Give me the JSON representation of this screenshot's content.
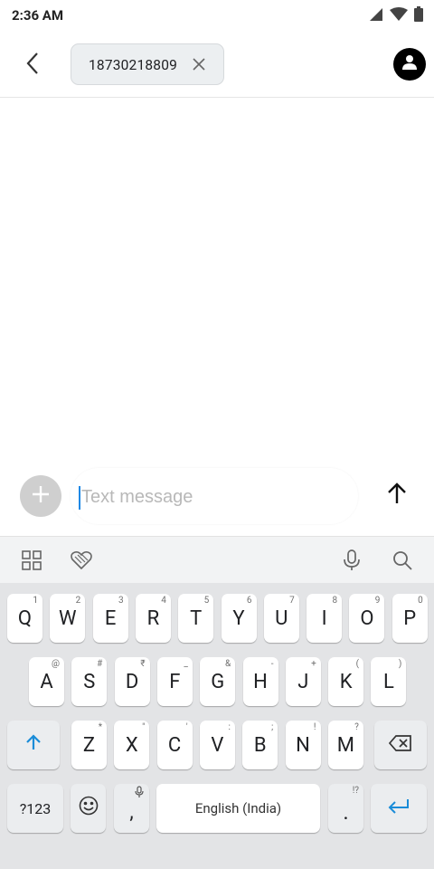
{
  "status_bar": {
    "time": "2:36 AM",
    "icons": [
      "signal-icon",
      "wifi-icon",
      "battery-icon"
    ]
  },
  "app_bar": {
    "recipient": "18730218809"
  },
  "compose": {
    "placeholder": "Text message"
  },
  "keyboard_toolbar": {
    "icons": [
      "apps-grid-icon",
      "sticker-heart-icon",
      "microphone-icon",
      "search-icon"
    ]
  },
  "keyboard": {
    "row1": [
      {
        "k": "Q",
        "h": "1"
      },
      {
        "k": "W",
        "h": "2"
      },
      {
        "k": "E",
        "h": "3"
      },
      {
        "k": "R",
        "h": "4"
      },
      {
        "k": "T",
        "h": "5"
      },
      {
        "k": "Y",
        "h": "6"
      },
      {
        "k": "U",
        "h": "7"
      },
      {
        "k": "I",
        "h": "8"
      },
      {
        "k": "O",
        "h": "9"
      },
      {
        "k": "P",
        "h": "0"
      }
    ],
    "row2": [
      {
        "k": "A",
        "h": "@"
      },
      {
        "k": "S",
        "h": "#"
      },
      {
        "k": "D",
        "h": "₹"
      },
      {
        "k": "F",
        "h": "_"
      },
      {
        "k": "G",
        "h": "&"
      },
      {
        "k": "H",
        "h": "-"
      },
      {
        "k": "J",
        "h": "+"
      },
      {
        "k": "K",
        "h": "("
      },
      {
        "k": "L",
        "h": ")"
      }
    ],
    "row3": [
      {
        "k": "Z",
        "h": "*"
      },
      {
        "k": "X",
        "h": "\""
      },
      {
        "k": "C",
        "h": "'"
      },
      {
        "k": "V",
        "h": ":"
      },
      {
        "k": "B",
        "h": ";"
      },
      {
        "k": "N",
        "h": "!"
      },
      {
        "k": "M",
        "h": "?"
      }
    ],
    "symbols_label": "?123",
    "comma_label": ",",
    "space_label": "English (India)",
    "period_label": ".",
    "period_hint": "!?"
  },
  "colors": {
    "accent": "#1a8cd8",
    "keyboard_bg": "#e3e4e6",
    "key_bg": "#ffffff"
  }
}
